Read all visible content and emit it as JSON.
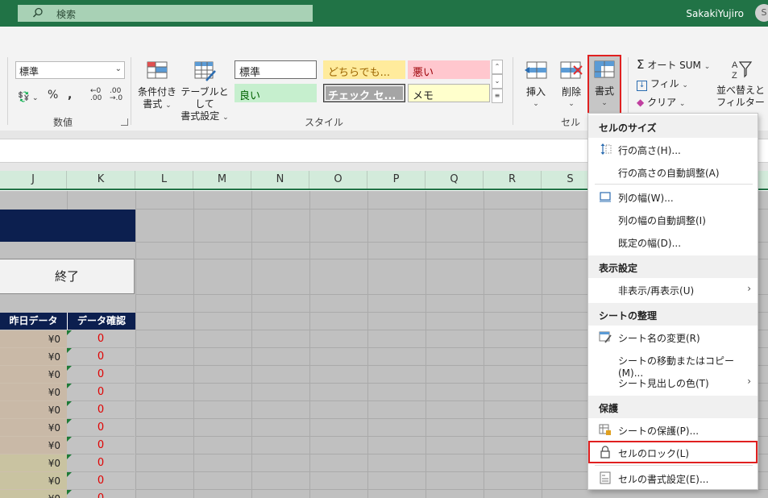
{
  "titlebar": {
    "search_placeholder": "検索",
    "user_name": "SakakiYujiro",
    "avatar_initial": "S"
  },
  "ribbon": {
    "number_format": "標準",
    "group_number_label": "数値",
    "group_style_label": "スタイル",
    "group_cells_label": "セル",
    "conditional_format": "条件付き",
    "conditional_format2": "書式",
    "table_format": "テーブルとして",
    "table_format2": "書式設定",
    "styles": [
      {
        "label": "標準",
        "bg": "#ffffff",
        "color": "#222222",
        "border": "#6a6a6a"
      },
      {
        "label": "どちらでも...",
        "bg": "#ffeb9c",
        "color": "#9c6500",
        "border": "#ffeb9c"
      },
      {
        "label": "悪い",
        "bg": "#ffc7ce",
        "color": "#9c0006",
        "border": "#ffc7ce"
      },
      {
        "label": "良い",
        "bg": "#c6efce",
        "color": "#006100",
        "border": "#c6efce"
      },
      {
        "label": "チェック セ...",
        "bg": "#a5a5a5",
        "color": "#ffffff",
        "border": "#3f3f3f"
      },
      {
        "label": "メモ",
        "bg": "#ffffcc",
        "color": "#222222",
        "border": "#b2b2b2"
      }
    ],
    "insert": "挿入",
    "delete": "削除",
    "format": "書式",
    "autosum": "オート SUM",
    "fill": "フィル",
    "clear": "クリア",
    "sort_filter": "並べ替えと",
    "sort_filter2": "フィルター"
  },
  "columns": [
    "J",
    "K",
    "L",
    "M",
    "N",
    "O",
    "P",
    "Q",
    "R",
    "S"
  ],
  "sheet": {
    "end_button": "終了",
    "header_yesterday": "昨日データ",
    "header_check": "データ確認",
    "rows": [
      {
        "amount": "¥0",
        "check": "0"
      },
      {
        "amount": "¥0",
        "check": "0"
      },
      {
        "amount": "¥0",
        "check": "0"
      },
      {
        "amount": "¥0",
        "check": "0"
      },
      {
        "amount": "¥0",
        "check": "0"
      },
      {
        "amount": "¥0",
        "check": "0"
      },
      {
        "amount": "¥0",
        "check": "0"
      },
      {
        "amount": "¥0",
        "check": "0"
      },
      {
        "amount": "¥0",
        "check": "0"
      },
      {
        "amount": "¥0",
        "check": "0"
      }
    ]
  },
  "menu": {
    "section_cell_size": "セルのサイズ",
    "row_height": "行の高さ(H)...",
    "row_autofit": "行の高さの自動調整(A)",
    "col_width": "列の幅(W)...",
    "col_autofit": "列の幅の自動調整(I)",
    "default_width": "既定の幅(D)...",
    "section_visibility": "表示設定",
    "hide_unhide": "非表示/再表示(U)",
    "section_sheet": "シートの整理",
    "rename_sheet": "シート名の変更(R)",
    "move_copy": "シートの移動またはコピー(M)...",
    "tab_color": "シート見出しの色(T)",
    "section_protect": "保護",
    "protect_sheet": "シートの保護(P)...",
    "lock_cell": "セルのロック(L)",
    "format_cells": "セルの書式設定(E)..."
  },
  "colors": {
    "excel_green": "#217346",
    "highlight_red": "#e02020",
    "navy": "#0c1f4f"
  }
}
